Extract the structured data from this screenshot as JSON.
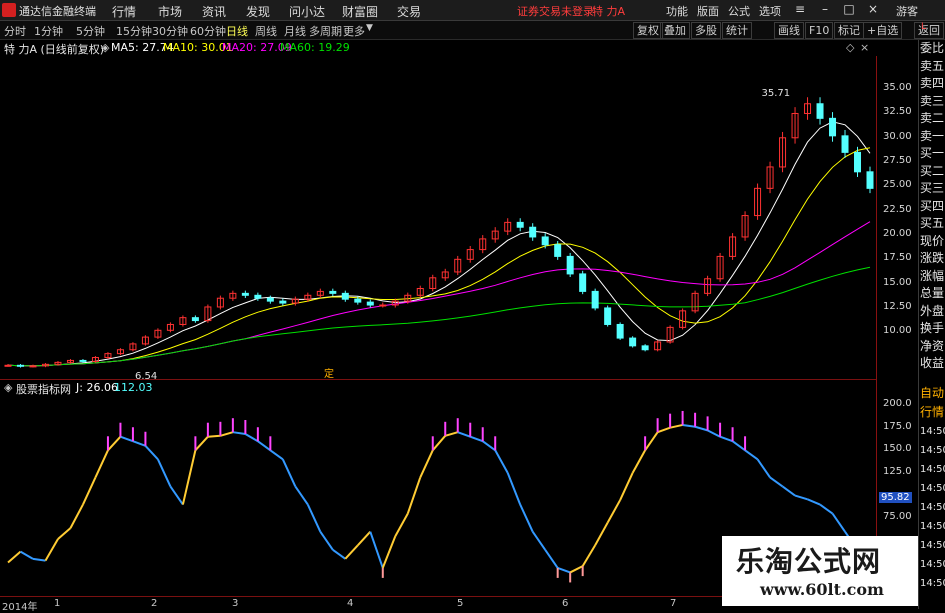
{
  "app": {
    "title": "通达信金融终端"
  },
  "menu": [
    "行情",
    "市场",
    "资讯",
    "发现",
    "问小达",
    "财富圈",
    "交易"
  ],
  "alert": "证券交易未登录",
  "stock_name": "特 力A",
  "toolbar": [
    "功能",
    "版面",
    "公式",
    "选项"
  ],
  "user": "游客",
  "periods": [
    "分时",
    "1分钟",
    "5分钟",
    "15分钟",
    "30分钟",
    "60分钟",
    "日线",
    "周线",
    "月线",
    "多周期",
    "更多"
  ],
  "active_period": "日线",
  "chart_tools": [
    "复权",
    "叠加",
    "多股",
    "统计",
    "画线",
    "F10",
    "标记",
    "+自选",
    "返回"
  ],
  "main_info": {
    "title": "特 力A (日线前复权)",
    "ma5": "MA5: 27.74",
    "ma10": "MA10: 30.01",
    "ma20": "MA20: 27.09",
    "ma60": "MA60: 19.29"
  },
  "sub_info": {
    "name": "股票指标网",
    "j": "J: 26.06",
    "v2": "112.03"
  },
  "labels": {
    "high": "35.71",
    "low": "6.54",
    "event": "定"
  },
  "price_ticks": [
    "35.00",
    "32.50",
    "30.00",
    "27.50",
    "25.00",
    "22.50",
    "20.00",
    "17.50",
    "15.00",
    "12.50",
    "10.00"
  ],
  "sub_ticks": [
    "200.0",
    "175.0",
    "150.0",
    "125.0",
    "95.82",
    "75.00"
  ],
  "side_items": [
    "委比",
    "卖五",
    "卖四",
    "卖三",
    "卖二",
    "卖一",
    "买一",
    "买二",
    "买三",
    "买四",
    "买五",
    "现价",
    "涨跌",
    "涨幅",
    "总量",
    "外盘",
    "换手",
    "净资",
    "收益"
  ],
  "side_items2": [
    "自动",
    "行情",
    "14:50",
    "14:50",
    "14:50",
    "14:50",
    "14:50",
    "14:50",
    "14:50",
    "14:50",
    "14:50"
  ],
  "dates": [
    "2014年",
    "1",
    "2",
    "3",
    "4",
    "5",
    "6",
    "7"
  ],
  "watermark": {
    "title": "乐淘公式网",
    "url": "www.60lt.com"
  },
  "colors": {
    "up": "#ff3232",
    "down": "#54ffff",
    "ma5": "#ffffff",
    "ma10": "#ffff00",
    "ma20": "#ff00ff",
    "ma60": "#00e000"
  },
  "chart_data": {
    "type": "candlestick",
    "close": [
      6.6,
      6.5,
      6.54,
      6.7,
      6.9,
      7.1,
      7.0,
      7.4,
      7.8,
      8.2,
      8.8,
      9.5,
      10.2,
      10.8,
      11.5,
      11.2,
      12.6,
      13.5,
      14.0,
      13.8,
      13.5,
      13.2,
      13.0,
      13.4,
      13.8,
      14.2,
      14.0,
      13.4,
      13.1,
      12.8,
      12.8,
      13.2,
      13.8,
      14.5,
      15.6,
      16.2,
      17.5,
      18.5,
      19.6,
      20.4,
      21.3,
      20.8,
      19.8,
      19.0,
      17.8,
      16.0,
      14.2,
      12.5,
      10.8,
      9.4,
      8.6,
      8.2,
      9.0,
      10.5,
      12.2,
      14.0,
      15.5,
      17.8,
      19.8,
      22.0,
      24.8,
      27.0,
      30.0,
      32.5,
      33.5,
      32.0,
      30.2,
      28.5,
      26.5,
      24.8
    ],
    "ylim": [
      5.5,
      38
    ],
    "indicator": [
      26,
      38,
      30,
      28,
      52,
      64,
      90,
      120,
      150,
      165,
      160,
      155,
      140,
      110,
      90,
      150,
      165,
      166,
      170,
      168,
      160,
      150,
      140,
      110,
      90,
      60,
      40,
      30,
      45,
      60,
      20,
      55,
      80,
      120,
      150,
      166,
      170,
      165,
      160,
      150,
      125,
      90,
      60,
      40,
      20,
      15,
      22,
      45,
      70,
      95,
      125,
      150,
      170,
      175,
      178,
      176,
      172,
      165,
      160,
      150,
      140,
      120,
      110,
      100,
      95.82,
      90,
      80,
      60,
      40,
      26.06
    ],
    "indicator_ylim": [
      0,
      210
    ]
  }
}
